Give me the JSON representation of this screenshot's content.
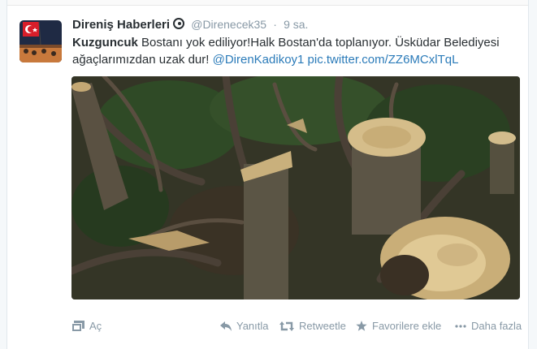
{
  "tweet": {
    "author_name": "Direniş Haberleri",
    "handle": "@Direnecek35",
    "separator": "·",
    "time": "9 sa.",
    "text_bold": "Kuzguncuk",
    "text_line1_rest": " Bostanı yok ediliyor!Halk Bostan'da toplanıyor. Üsküdar Belediyesi",
    "text_line2": "ağaçlarımızdan uzak dur! ",
    "mention": "@DirenKadikoy1",
    "pic_link": "pic.twitter.com/ZZ6MCxlTqL"
  },
  "actions": {
    "expand": "Aç",
    "reply": "Yanıtla",
    "retweet": "Retweetle",
    "favorite": "Favorilere ekle",
    "more": "Daha fazla"
  },
  "icons": {
    "verified": "verified-badge-icon",
    "expand": "expand-media-icon",
    "reply": "reply-icon",
    "retweet": "retweet-icon",
    "favorite": "star-icon",
    "more": "ellipsis-icon"
  },
  "colors": {
    "link": "#2b7bb9",
    "muted": "#8899a6",
    "text": "#292f33"
  }
}
